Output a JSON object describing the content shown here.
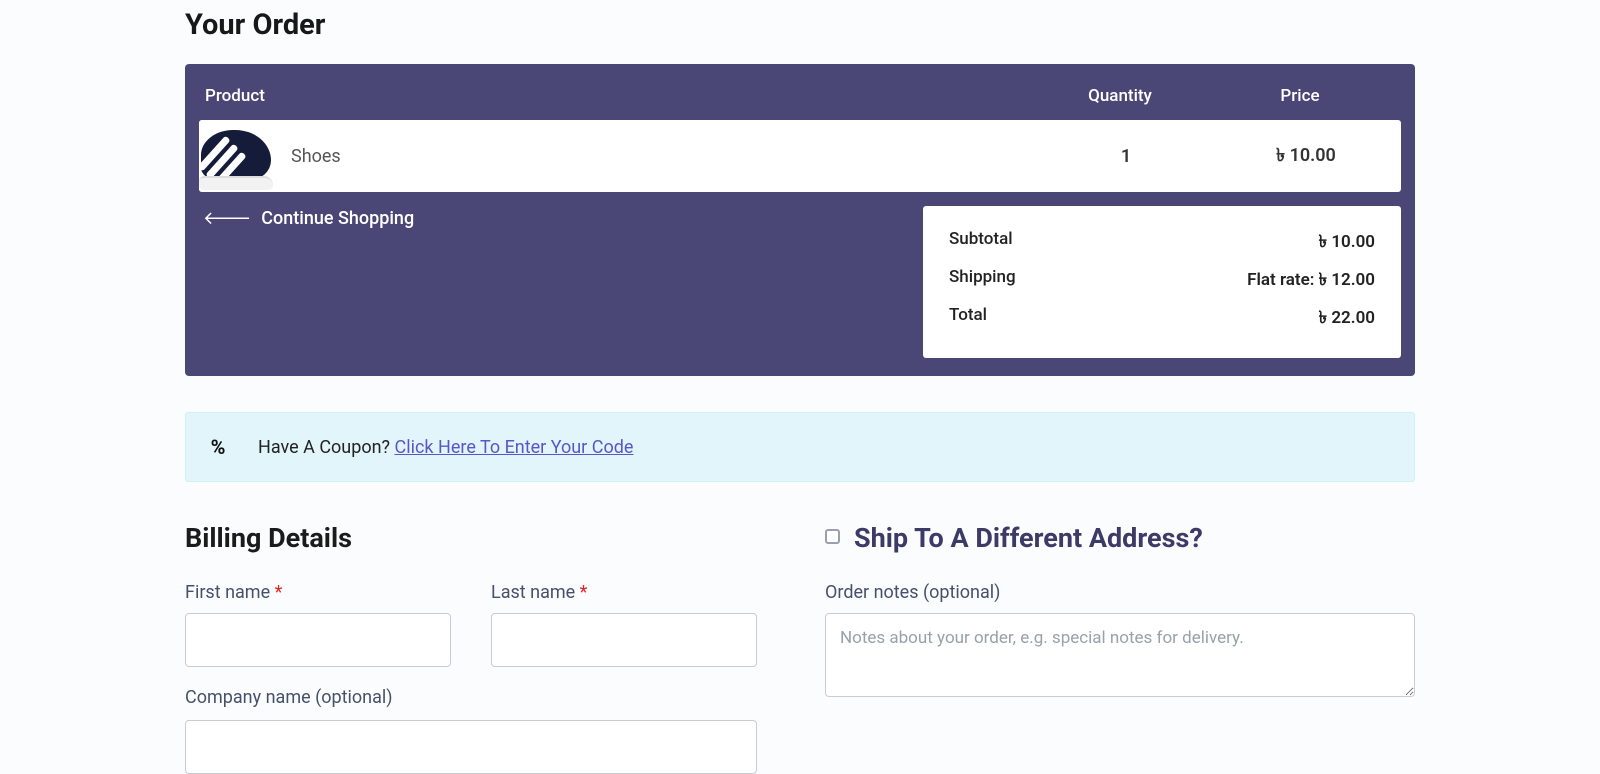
{
  "order": {
    "title": "Your Order",
    "headers": {
      "product": "Product",
      "quantity": "Quantity",
      "price": "Price"
    },
    "item": {
      "name": "Shoes",
      "quantity": "1",
      "price": "৳ 10.00"
    },
    "continue_label": "Continue Shopping",
    "totals": {
      "subtotal_label": "Subtotal",
      "subtotal_value": "৳ 10.00",
      "shipping_label": "Shipping",
      "shipping_value": "Flat rate: ৳ 12.00",
      "total_label": "Total",
      "total_value": "৳ 22.00"
    }
  },
  "coupon": {
    "prompt": "Have A Coupon? ",
    "link": "Click Here To Enter Your Code"
  },
  "billing": {
    "title": "Billing Details",
    "first_name_label": "First name ",
    "last_name_label": "Last name ",
    "company_label": "Company name (optional)"
  },
  "shipping": {
    "title": "Ship To A Different Address?",
    "notes_label": "Order notes (optional)",
    "notes_placeholder": "Notes about your order, e.g. special notes for delivery."
  }
}
